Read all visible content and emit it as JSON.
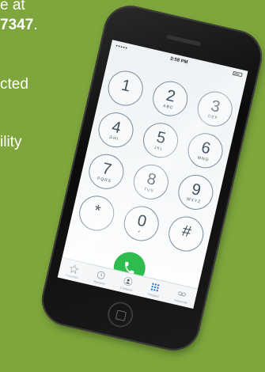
{
  "background_text": {
    "line1": "e at",
    "line2": "7347",
    "line2_suffix": ".",
    "line3": "cted",
    "line4": "ility"
  },
  "status_bar": {
    "signal": "•••••",
    "time": "3:58 PM"
  },
  "keypad": [
    {
      "digit": "1",
      "letters": ""
    },
    {
      "digit": "2",
      "letters": "ABC"
    },
    {
      "digit": "3",
      "letters": "DEF"
    },
    {
      "digit": "4",
      "letters": "GHI"
    },
    {
      "digit": "5",
      "letters": "JKL"
    },
    {
      "digit": "6",
      "letters": "MNO"
    },
    {
      "digit": "7",
      "letters": "PQRS"
    },
    {
      "digit": "8",
      "letters": "TUV"
    },
    {
      "digit": "9",
      "letters": "WXYZ"
    },
    {
      "digit": "*",
      "letters": ""
    },
    {
      "digit": "0",
      "letters": "+"
    },
    {
      "digit": "#",
      "letters": ""
    }
  ],
  "tabs": [
    {
      "label": "Favorites",
      "icon": "star-icon"
    },
    {
      "label": "Recents",
      "icon": "clock-icon"
    },
    {
      "label": "Contacts",
      "icon": "person-icon"
    },
    {
      "label": "Keypad",
      "icon": "keypad-icon"
    },
    {
      "label": "Voicemail",
      "icon": "voicemail-icon"
    }
  ],
  "colors": {
    "background": "#7ea63c",
    "call_button": "#2ebc4f",
    "keypad_active": "#1a6fe0"
  }
}
